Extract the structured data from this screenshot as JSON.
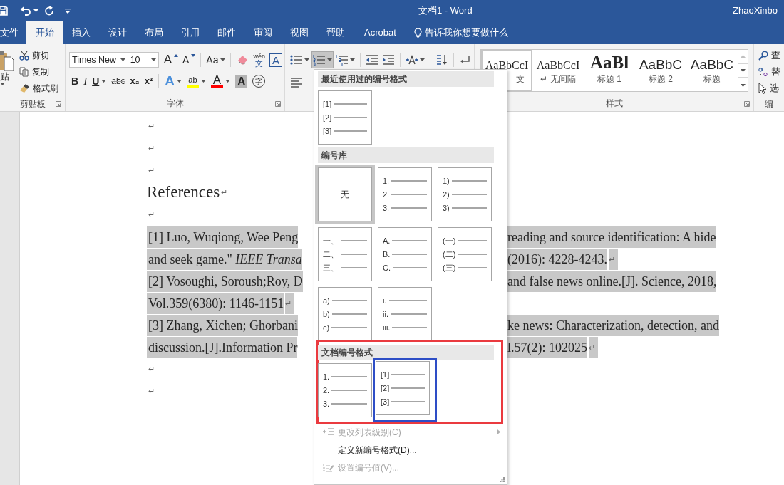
{
  "title_bar": {
    "title": "文档1 - Word",
    "user": "ZhaoXinbo"
  },
  "tabs": [
    {
      "label": "文件",
      "selected": false
    },
    {
      "label": "开始",
      "selected": true
    },
    {
      "label": "插入",
      "selected": false
    },
    {
      "label": "设计",
      "selected": false
    },
    {
      "label": "布局",
      "selected": false
    },
    {
      "label": "引用",
      "selected": false
    },
    {
      "label": "邮件",
      "selected": false
    },
    {
      "label": "审阅",
      "selected": false
    },
    {
      "label": "视图",
      "selected": false
    },
    {
      "label": "帮助",
      "selected": false
    },
    {
      "label": "Acrobat",
      "selected": false
    }
  ],
  "tell_me": "告诉我你想要做什么",
  "clipboard": {
    "paste": "贴",
    "cut": "剪切",
    "copy": "复制",
    "format_painter": "格式刷",
    "label": "剪贴板"
  },
  "font": {
    "font_name": "Times New",
    "font_size": "10",
    "row1": [
      {
        "kind": "grow",
        "glyph": "A",
        "dropdown": false
      },
      {
        "kind": "shrink",
        "glyph": "A",
        "dropdown": false
      },
      {
        "kind": "case",
        "glyph": "Aa",
        "dropdown": true
      },
      {
        "kind": "clear",
        "dropdown": false
      },
      {
        "kind": "phonetic",
        "glyph": "wén",
        "glyph2": "文",
        "dropdown": false
      },
      {
        "kind": "border",
        "glyph": "A",
        "dropdown": false
      }
    ],
    "row2": [
      {
        "kind": "bold",
        "glyph": "B",
        "dropdown": false
      },
      {
        "kind": "italic",
        "glyph": "I",
        "dropdown": false
      },
      {
        "kind": "underline",
        "glyph": "U",
        "dropdown": true
      },
      {
        "kind": "strike",
        "glyph": "abc",
        "dropdown": false
      },
      {
        "kind": "sub",
        "glyph": "x₂",
        "dropdown": false
      },
      {
        "kind": "sup",
        "glyph": "x²",
        "dropdown": false
      },
      {
        "kind": "effects",
        "glyph": "A",
        "dropdown": true
      },
      {
        "kind": "highlight",
        "glyph": "ab",
        "color": "#ffff00",
        "dropdown": true
      },
      {
        "kind": "font_color",
        "glyph": "A",
        "color": "#ff0000",
        "dropdown": true
      },
      {
        "kind": "shading",
        "glyph": "A",
        "dropdown": false
      },
      {
        "kind": "enclose",
        "glyph": "字",
        "dropdown": false
      }
    ],
    "label": "字体"
  },
  "paragraph": {
    "row1": [
      {
        "kind": "bullets",
        "dropdown": true,
        "pressed": false
      },
      {
        "kind": "numbering",
        "dropdown": true,
        "pressed": true
      },
      {
        "kind": "multilevel",
        "dropdown": true,
        "pressed": false
      },
      {
        "kind": "outdent",
        "dropdown": false,
        "pressed": false
      },
      {
        "kind": "indent",
        "dropdown": false,
        "pressed": false
      },
      {
        "kind": "asian_layout",
        "dropdown": true,
        "pressed": false
      },
      {
        "kind": "sort",
        "dropdown": false,
        "pressed": false
      },
      {
        "kind": "show_marks",
        "dropdown": false,
        "pressed": false
      }
    ],
    "row2": [
      {
        "kind": "align_left",
        "dropdown": false,
        "pressed": false
      }
    ]
  },
  "styles": {
    "items": [
      {
        "kind": "normal",
        "preview": "AaBbCcI",
        "name": "文",
        "selected": true
      },
      {
        "kind": "no_spacing",
        "preview": "AaBbCcI",
        "name": "↵ 无间隔",
        "selected": false
      },
      {
        "kind": "heading1",
        "preview": "AaBl",
        "name": "标题 1",
        "selected": false
      },
      {
        "kind": "heading2",
        "preview": "AaBbC",
        "name": "标题 2",
        "selected": false
      },
      {
        "kind": "title",
        "preview": "AaBbC",
        "name": "标题",
        "selected": false
      }
    ],
    "label": "样式"
  },
  "editing": {
    "find": "查",
    "replace": "替",
    "select": "选",
    "label": "编"
  },
  "document": {
    "blocks": [
      {
        "kind": "empty",
        "mark": "↵"
      },
      {
        "kind": "empty",
        "mark": "↵"
      },
      {
        "kind": "empty",
        "mark": "↵"
      },
      {
        "kind": "heading",
        "text": "References",
        "mark": "↵"
      },
      {
        "kind": "empty",
        "mark": "↵"
      },
      {
        "kind": "line",
        "left": "[1] Luo, Wuqiong, Wee Peng",
        "right": "reading and source identification: A hide"
      },
      {
        "kind": "line",
        "left": "and seek game.\" *IEEE Transa*",
        "right": "(2016): 4228-4243.",
        "mark": "↵"
      },
      {
        "kind": "line",
        "left": "[2] Vosoughi, Soroush;Roy, D",
        "right": "and false news online.[J]. Science, 2018,"
      },
      {
        "kind": "line",
        "left": "Vol.359(6380): 1146-1151",
        "mark": "↵"
      },
      {
        "kind": "line",
        "left": "[3] Zhang, Xichen; Ghorbani",
        "right": "ke news: Characterization, detection, and"
      },
      {
        "kind": "line",
        "left": "discussion.[J].Information Pr",
        "right": "l.57(2): 102025",
        "mark": "↵"
      },
      {
        "kind": "empty",
        "mark": "↵"
      },
      {
        "kind": "empty",
        "mark": "↵"
      }
    ]
  },
  "numbering_menu": {
    "sections": [
      {
        "title": "最近使用过的编号格式",
        "annotated": false,
        "tiles": [
          {
            "kind": "list",
            "labels": [
              "[1]",
              "[2]",
              "[3]"
            ],
            "selected": false,
            "annotated": false
          }
        ]
      },
      {
        "title": "编号库",
        "annotated": false,
        "tiles": [
          {
            "kind": "none",
            "label": "无",
            "selected": true,
            "annotated": false
          },
          {
            "kind": "list",
            "labels": [
              "1.",
              "2.",
              "3."
            ],
            "selected": false,
            "annotated": false
          },
          {
            "kind": "list",
            "labels": [
              "1)",
              "2)",
              "3)"
            ],
            "selected": false,
            "annotated": false
          },
          {
            "kind": "list",
            "labels": [
              "一、",
              "二、",
              "三、"
            ],
            "selected": false,
            "annotated": false
          },
          {
            "kind": "list",
            "labels": [
              "A.",
              "B.",
              "C."
            ],
            "selected": false,
            "annotated": false
          },
          {
            "kind": "list",
            "labels": [
              "(一)",
              "(二)",
              "(三)"
            ],
            "selected": false,
            "annotated": false
          },
          {
            "kind": "list",
            "labels": [
              "a)",
              "b)",
              "c)"
            ],
            "selected": false,
            "annotated": false
          },
          {
            "kind": "list",
            "labels": [
              "i.",
              "ii.",
              "iii."
            ],
            "selected": false,
            "annotated": false
          }
        ]
      },
      {
        "title": "文档编号格式",
        "annotated": true,
        "tiles": [
          {
            "kind": "list",
            "labels": [
              "1.",
              "2.",
              "3."
            ],
            "selected": false,
            "annotated": false
          },
          {
            "kind": "list",
            "labels": [
              "[1]",
              "[2]",
              "[3]"
            ],
            "selected": false,
            "annotated": true
          }
        ]
      }
    ],
    "items": [
      {
        "kind": "list_level",
        "label": "更改列表级别(C)",
        "disabled": true,
        "submenu": true
      },
      {
        "kind": "define",
        "label": "定义新编号格式(D)...",
        "disabled": false,
        "submenu": false
      },
      {
        "kind": "set_value",
        "label": "设置编号值(V)...",
        "disabled": true,
        "submenu": false
      }
    ]
  }
}
